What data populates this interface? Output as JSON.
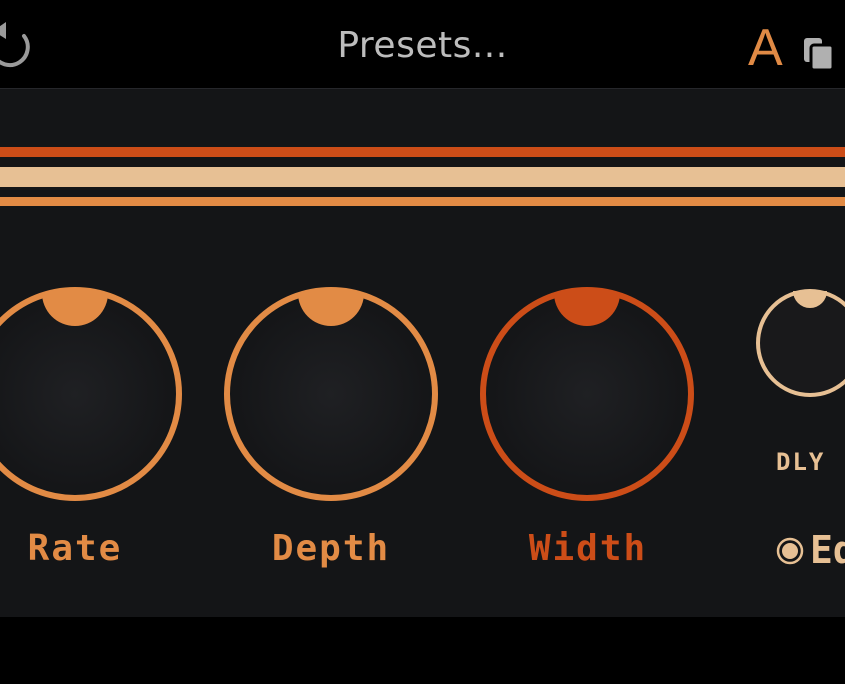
{
  "header": {
    "presets_label": "Presets...",
    "ab_label": "A",
    "undo_icon": "undo-icon",
    "copy_icon": "copy-icon"
  },
  "colors": {
    "accent_orange": "#e28b45",
    "accent_red": "#cc4d18",
    "accent_cream": "#e7c094",
    "panel_bg": "#141517",
    "header_bg": "#000000"
  },
  "knobs": [
    {
      "label": "Rate",
      "color": "#e28b45"
    },
    {
      "label": "Depth",
      "color": "#e28b45"
    },
    {
      "label": "Width",
      "color": "#cc4d18"
    },
    {
      "label": "DLY",
      "color": "#e7c094"
    }
  ],
  "mode": {
    "label": "Ed"
  }
}
